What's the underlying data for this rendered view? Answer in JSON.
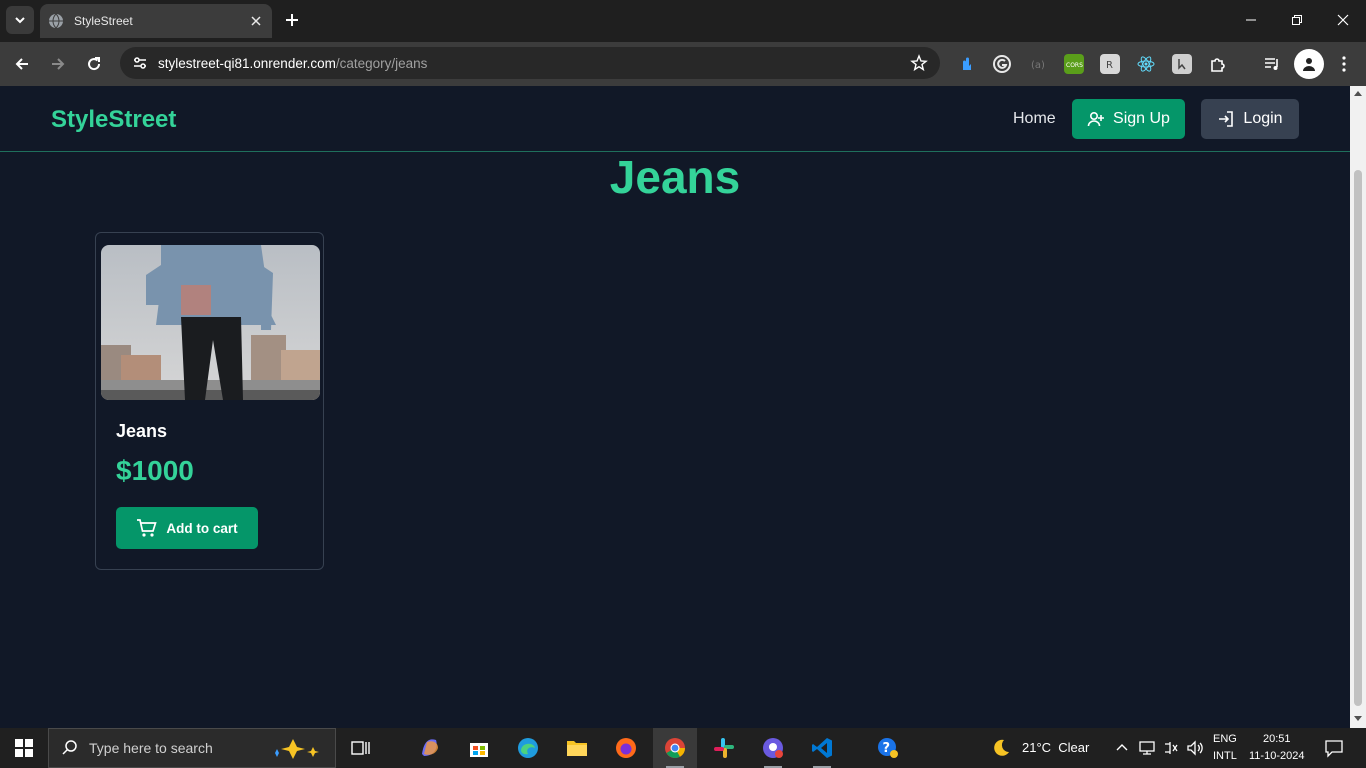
{
  "browser": {
    "tab_title": "StyleStreet",
    "url_host": "stylestreet-qi81.onrender.com",
    "url_path": "/category/jeans"
  },
  "site": {
    "logo": "StyleStreet",
    "nav": {
      "home": "Home",
      "signup": "Sign Up",
      "login": "Login"
    },
    "category_title": "Jeans",
    "products": [
      {
        "name": "Jeans",
        "price": "$1000",
        "add_to_cart": "Add to cart"
      }
    ]
  },
  "taskbar": {
    "search_placeholder": "Type here to search",
    "weather": "21°C  Clear",
    "lang_top": "ENG",
    "lang_bottom": "INTL",
    "time": "20:51",
    "date": "11-10-2024"
  },
  "colors": {
    "accent": "#34d399",
    "button_green": "#059669",
    "page_bg": "#111827",
    "login_bg": "#374151"
  }
}
